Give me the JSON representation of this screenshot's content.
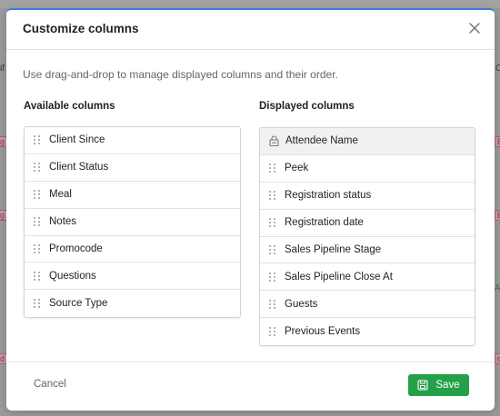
{
  "modal": {
    "title": "Customize columns",
    "description": "Use drag-and-drop to manage displayed columns and their order."
  },
  "available": {
    "title": "Available columns",
    "items": [
      "Client Since",
      "Client Status",
      "Meal",
      "Notes",
      "Promocode",
      "Questions",
      "Source Type"
    ]
  },
  "displayed": {
    "title": "Displayed columns",
    "locked_item": "Attendee Name",
    "items": [
      "Peek",
      "Registration status",
      "Registration date",
      "Sales Pipeline Stage",
      "Sales Pipeline Close At",
      "Guests",
      "Previous Events"
    ]
  },
  "footer": {
    "cancel_label": "Cancel",
    "save_label": "Save"
  },
  "colors": {
    "accent": "#3f7ad9",
    "save": "#24a148"
  },
  "icons": {
    "close": "close-icon",
    "lock": "lock-icon",
    "drag": "drag-handle-icon",
    "save": "save-icon"
  }
}
